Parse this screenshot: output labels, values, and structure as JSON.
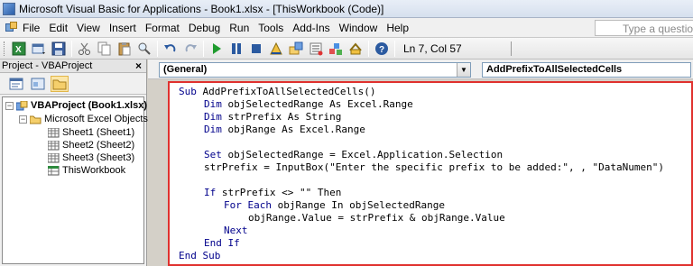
{
  "window": {
    "title": "Microsoft Visual Basic for Applications - Book1.xlsx - [ThisWorkbook (Code)]"
  },
  "menu": {
    "items": [
      "File",
      "Edit",
      "View",
      "Insert",
      "Format",
      "Debug",
      "Run",
      "Tools",
      "Add-Ins",
      "Window",
      "Help"
    ],
    "help_placeholder": "Type a question for"
  },
  "toolbar": {
    "status": "Ln 7, Col 57"
  },
  "project": {
    "title": "Project - VBAProject",
    "close_label": "×",
    "tree": {
      "root": "VBAProject (Book1.xlsx)",
      "folder": "Microsoft Excel Objects",
      "items": [
        "Sheet1 (Sheet1)",
        "Sheet2 (Sheet2)",
        "Sheet3 (Sheet3)",
        "ThisWorkbook"
      ]
    }
  },
  "editor": {
    "object_combo": "(General)",
    "procedure_combo": "AddPrefixToAllSelectedCells",
    "lines": [
      {
        "kw": "Sub",
        "rest": " AddPrefixToAllSelectedCells()"
      },
      {
        "kw": "Dim",
        "rest": " objSelectedRange As Excel.Range"
      },
      {
        "kw": "Dim",
        "rest": " strPrefix As String"
      },
      {
        "kw": "Dim",
        "rest": " objRange As Excel.Range"
      },
      {
        "kw": "",
        "rest": ""
      },
      {
        "kw": "Set",
        "rest": " objSelectedRange = Excel.Application.Selection"
      },
      {
        "kw": "",
        "rest": "strPrefix = InputBox(\"Enter the specific prefix to be added:\", , \"DataNumen\")"
      },
      {
        "kw": "",
        "rest": ""
      },
      {
        "kw": "If",
        "rest": " strPrefix <> \"\" Then"
      },
      {
        "kw": "For Each",
        "rest": " objRange In objSelectedRange"
      },
      {
        "kw": "",
        "rest": "objRange.Value = strPrefix & objRange.Value"
      },
      {
        "kw": "Next",
        "rest": ""
      },
      {
        "kw": "End If",
        "rest": ""
      },
      {
        "kw": "End Sub",
        "rest": ""
      }
    ]
  }
}
